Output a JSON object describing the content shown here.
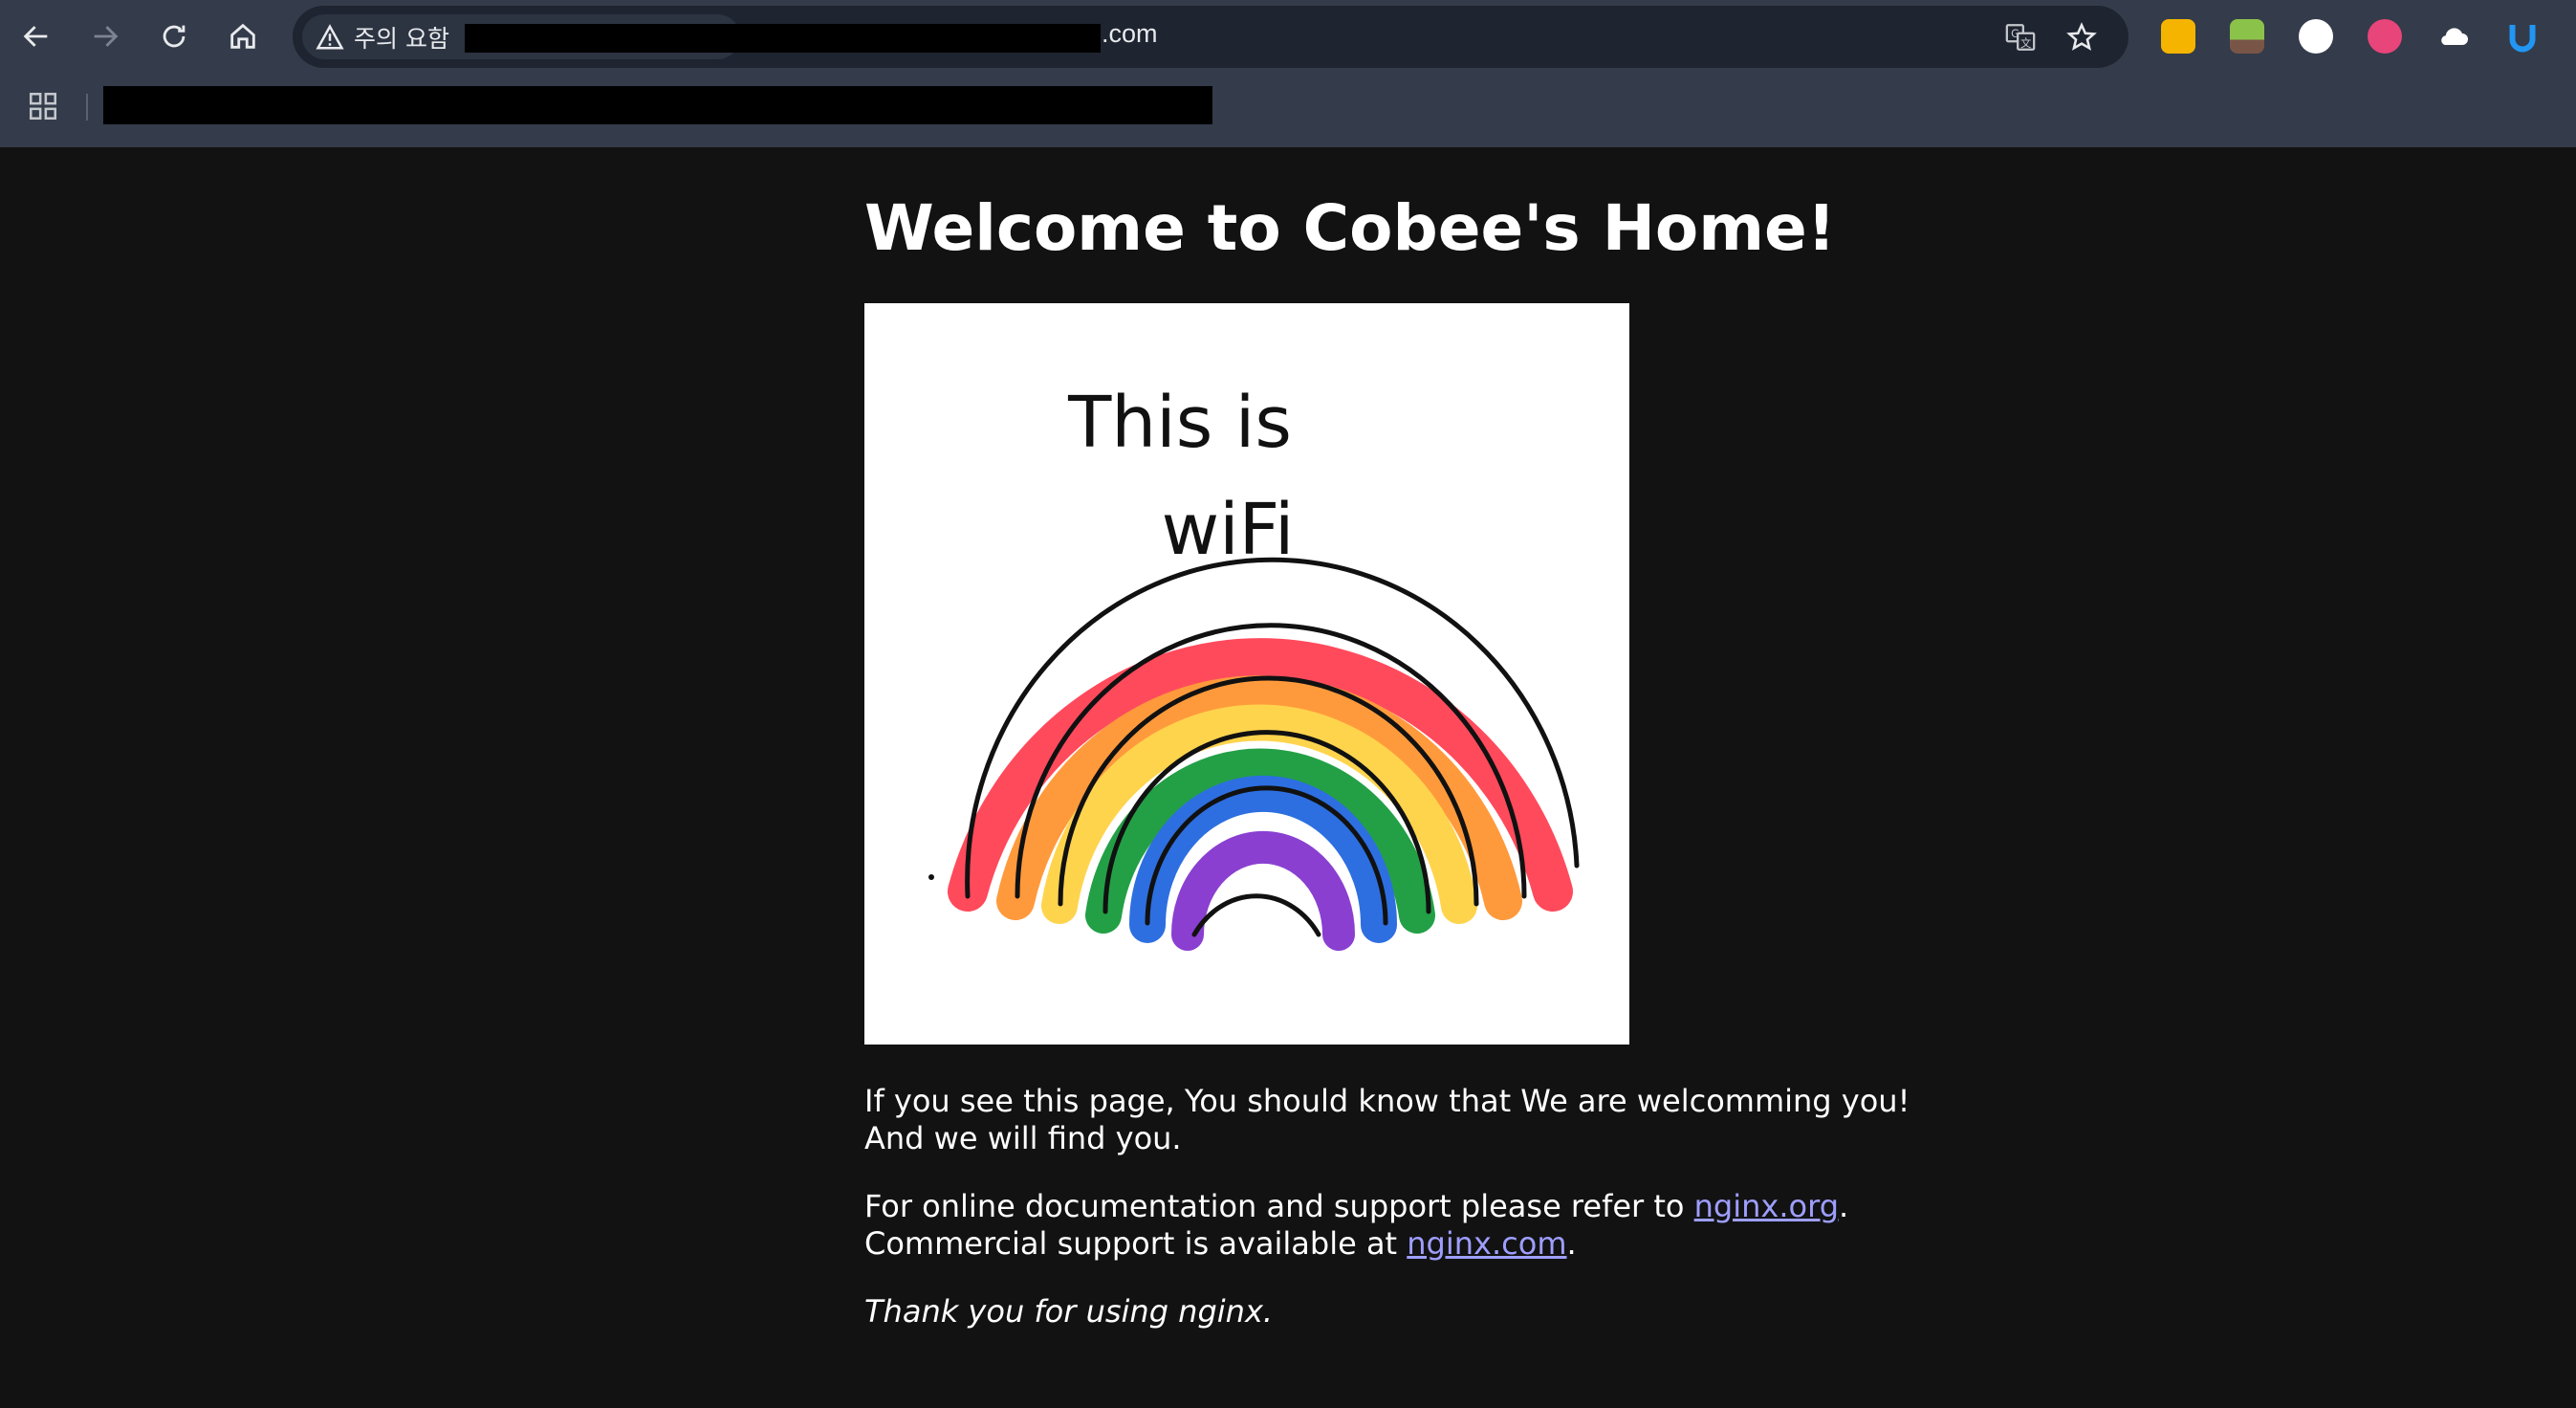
{
  "browser": {
    "security_chip": "주의 요함",
    "url_suffix": ".com",
    "nav": [
      "back-icon",
      "forward-icon",
      "reload-icon",
      "home-icon"
    ],
    "omnibox_icons": [
      "translate-icon",
      "bookmark-star-icon"
    ],
    "extensions": [
      {
        "name": "extension-yellow-icon",
        "color": "#f4b400"
      },
      {
        "name": "extension-green-icon",
        "color": "#8bc34a"
      },
      {
        "name": "extension-circle-icon",
        "color": "#ffffff"
      },
      {
        "name": "extension-pink-icon",
        "color": "#e8457a"
      },
      {
        "name": "extension-cloud-icon",
        "color": "#ffffff"
      },
      {
        "name": "extension-blue-icon",
        "color": "#2196f3"
      }
    ],
    "bookmarks_icon": "apps-grid-icon"
  },
  "page": {
    "heading": "Welcome to Cobee's Home!",
    "image_text_line1": "This is",
    "image_text_line2": "wiFi",
    "p1": "If you see this page, You should know that We are welcomming you! And we will find you.",
    "p2_prefix": "For online documentation and support please refer to ",
    "p2_link": "nginx.org",
    "p2_mid": ".",
    "p2_line2_prefix": "Commercial support is available at ",
    "p2_link2": "nginx.com",
    "p2_end": ".",
    "p3": "Thank you for using nginx."
  }
}
